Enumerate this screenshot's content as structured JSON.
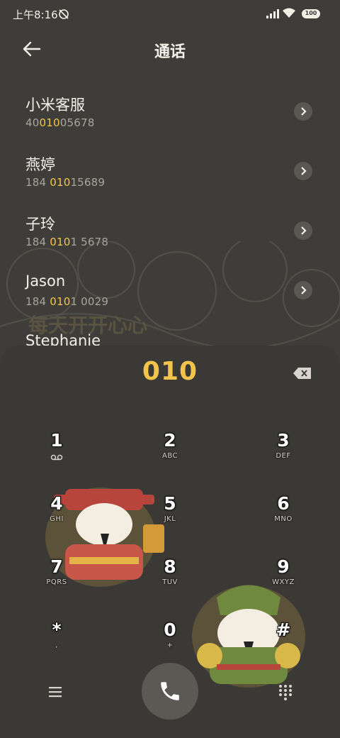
{
  "status": {
    "time": "上午8:16",
    "battery": "100"
  },
  "header": {
    "title": "通话"
  },
  "contacts": [
    {
      "name": "小米客服",
      "number_pre": "40",
      "number_hl": "010",
      "number_post": "05678"
    },
    {
      "name": "燕婷",
      "number_pre": "184 ",
      "number_hl": "010",
      "number_post": "15689"
    },
    {
      "name": "子玲",
      "number_pre": "184 ",
      "number_hl": "010",
      "number_post": "1 5678"
    },
    {
      "name": "Jason",
      "number_pre": "184 ",
      "number_hl": "010",
      "number_post": "1 0029"
    },
    {
      "name": "Stephanie"
    }
  ],
  "wallpaper_text": "每天开开心心",
  "dialpad": {
    "input": "010",
    "keys": [
      {
        "digit": "1",
        "letters": "voicemail-icon"
      },
      {
        "digit": "2",
        "letters": "ABC"
      },
      {
        "digit": "3",
        "letters": "DEF"
      },
      {
        "digit": "4",
        "letters": "GHI"
      },
      {
        "digit": "5",
        "letters": "JKL"
      },
      {
        "digit": "6",
        "letters": "MNO"
      },
      {
        "digit": "7",
        "letters": "PQRS"
      },
      {
        "digit": "8",
        "letters": "TUV"
      },
      {
        "digit": "9",
        "letters": "WXYZ"
      },
      {
        "digit": "*",
        "letters": ","
      },
      {
        "digit": "0",
        "letters": "+"
      },
      {
        "digit": "#",
        "letters": ""
      }
    ]
  },
  "colors": {
    "accent": "#f2c44a",
    "background": "#3f3d3a",
    "text": "#f2efe9"
  }
}
